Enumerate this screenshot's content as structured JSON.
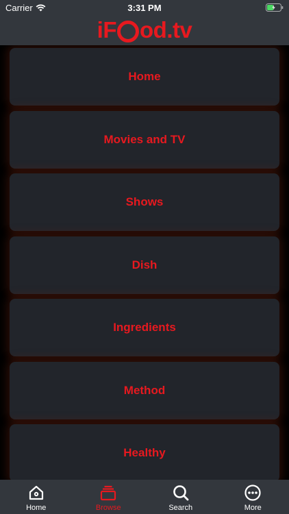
{
  "status_bar": {
    "carrier": "Carrier",
    "time": "3:31 PM"
  },
  "header": {
    "logo_prefix": "iF",
    "logo_suffix": "od.tv"
  },
  "menu": {
    "items": [
      {
        "label": "Home"
      },
      {
        "label": "Movies and TV"
      },
      {
        "label": "Shows"
      },
      {
        "label": "Dish"
      },
      {
        "label": "Ingredients"
      },
      {
        "label": "Method"
      },
      {
        "label": "Healthy"
      }
    ]
  },
  "tab_bar": {
    "tabs": [
      {
        "label": "Home",
        "icon": "home-icon"
      },
      {
        "label": "Browse",
        "icon": "browse-icon",
        "active": true
      },
      {
        "label": "Search",
        "icon": "search-icon"
      },
      {
        "label": "More",
        "icon": "more-icon"
      }
    ]
  },
  "colors": {
    "accent": "#e7191f",
    "bar_background": "#33373d",
    "tile_background": "#22252b",
    "page_background": "#000000"
  }
}
